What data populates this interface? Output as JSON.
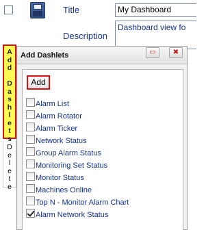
{
  "header": {
    "title_label": "Title",
    "title_value": "My Dashboard",
    "description_label": "Description",
    "description_value": "Dashboard view fo"
  },
  "tabs": {
    "add_dashlets": "A\nd\nd\n \nD\na\ns\nh\nl\ne\nt\ns",
    "delete": "D\ne\nl\ne\nt\ne"
  },
  "panel": {
    "title": "Add Dashlets",
    "restore_icon": "restore-icon",
    "close_icon": "close-icon",
    "add_button": "Add",
    "items": [
      {
        "label": "Alarm List",
        "checked": false
      },
      {
        "label": "Alarm Rotator",
        "checked": false
      },
      {
        "label": "Alarm Ticker",
        "checked": false
      },
      {
        "label": "Network Status",
        "checked": false
      },
      {
        "label": "Group Alarm Status",
        "checked": false
      },
      {
        "label": "Monitoring Set Status",
        "checked": false
      },
      {
        "label": "Monitor Status",
        "checked": false
      },
      {
        "label": "Machines Online",
        "checked": false
      },
      {
        "label": "Top N - Monitor Alarm Chart",
        "checked": false
      },
      {
        "label": "Alarm Network Status",
        "checked": true
      }
    ]
  },
  "colors": {
    "accent_red": "#d9120f",
    "tab_yellow": "#fafa52",
    "link_blue": "#14318c"
  }
}
